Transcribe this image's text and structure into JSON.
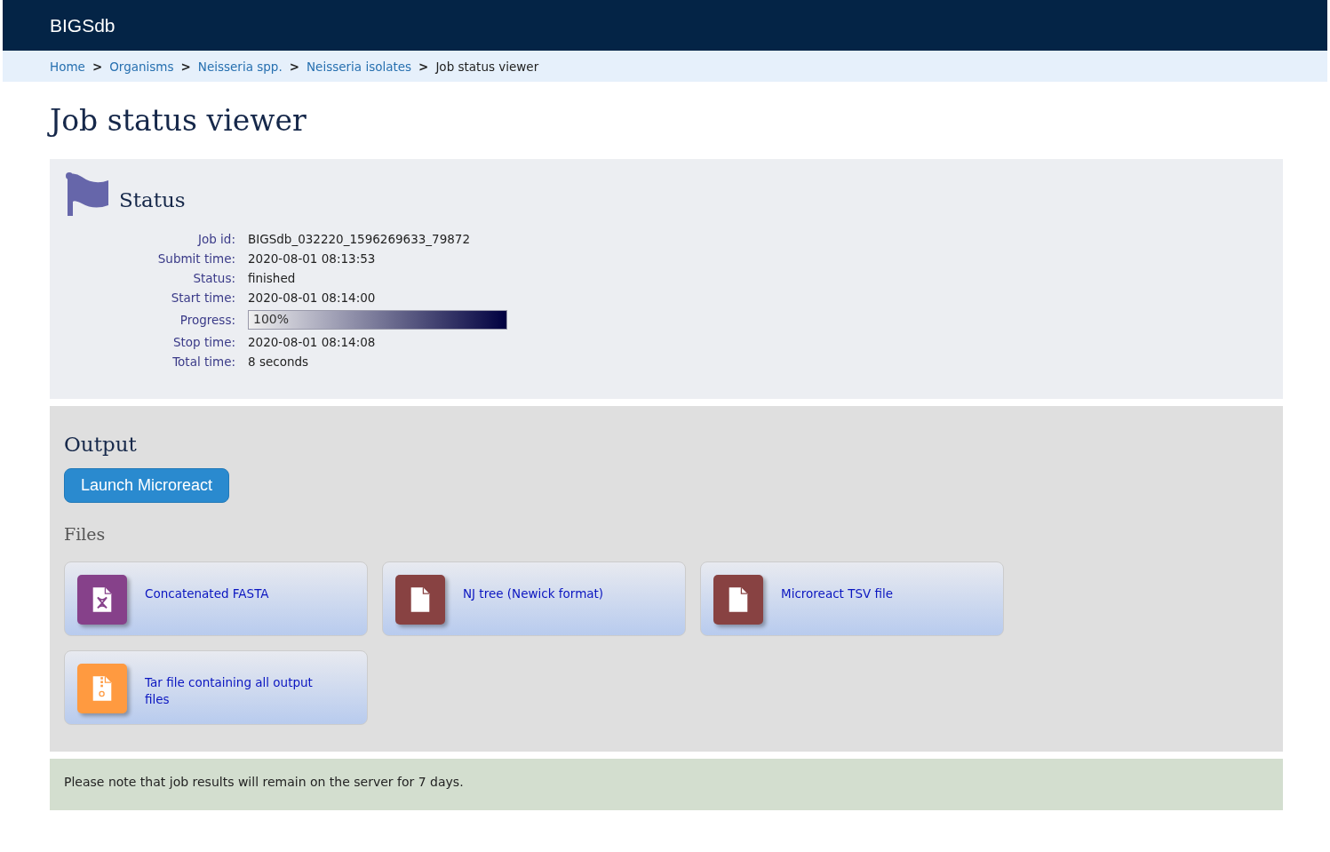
{
  "header": {
    "title": "BIGSdb"
  },
  "breadcrumbs": [
    {
      "label": "Home",
      "kind": "link"
    },
    {
      "label": "Organisms",
      "kind": "link"
    },
    {
      "label": "Neisseria spp.",
      "kind": "link"
    },
    {
      "label": "Neisseria isolates",
      "kind": "link"
    },
    {
      "label": "Job status viewer",
      "kind": "current"
    }
  ],
  "breadcrumb_separator": ">",
  "page_title": "Job status viewer",
  "status": {
    "heading": "Status",
    "fields": [
      {
        "label": "Job id:",
        "value": "BIGSdb_032220_1596269633_79872",
        "kind": "text"
      },
      {
        "label": "Submit time:",
        "value": "2020-08-01 08:13:53",
        "kind": "text"
      },
      {
        "label": "Status:",
        "value": "finished",
        "kind": "text"
      },
      {
        "label": "Start time:",
        "value": "2020-08-01 08:14:00",
        "kind": "text"
      },
      {
        "label": "Progress:",
        "value": "100%",
        "kind": "progress",
        "level": 1.0
      },
      {
        "label": "Stop time:",
        "value": "2020-08-01 08:14:08",
        "kind": "text"
      },
      {
        "label": "Total time:",
        "value": "8 seconds",
        "kind": "text"
      }
    ]
  },
  "output": {
    "heading": "Output",
    "button": "Launch Microreact",
    "files_heading": "Files",
    "files": [
      {
        "label": "Concatenated FASTA",
        "kind": "sequence",
        "color": "#86418a"
      },
      {
        "label": "NJ tree (Newick format)",
        "kind": "document",
        "color": "#884242"
      },
      {
        "label": "Microreact TSV file",
        "kind": "document",
        "color": "#884242"
      },
      {
        "label": "Tar file containing all output files",
        "kind": "archive",
        "color": "#ff9a40"
      }
    ]
  },
  "note": "Please note that job results will remain on the server for 7 days."
}
